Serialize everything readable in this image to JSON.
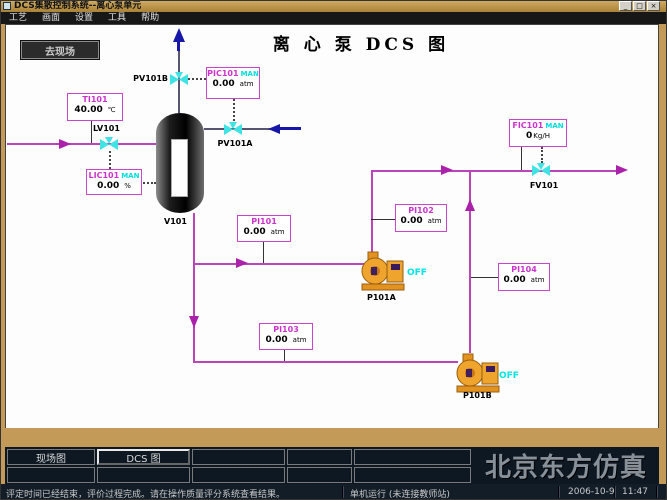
{
  "window": {
    "title": "DCS集散控制系统--离心泵单元",
    "minimize": "_",
    "maximize": "□",
    "close": "×"
  },
  "menu": {
    "items": [
      "工艺",
      "画面",
      "设置",
      "工具",
      "帮助"
    ]
  },
  "toolbar": {
    "go_field": "去现场"
  },
  "diagram": {
    "title": "离 心 泵 DCS 图",
    "vessel": {
      "label": "V101"
    },
    "valves": {
      "lv101": "LV101",
      "pv101a": "PV101A",
      "pv101b": "PV101B",
      "fv101": "FV101"
    },
    "pumps": {
      "p101a": {
        "label": "P101A",
        "status": "OFF"
      },
      "p101b": {
        "label": "P101B",
        "status": "OFF"
      }
    },
    "instruments": {
      "ti101": {
        "tag": "TI101",
        "value": "40.00",
        "unit": "℃"
      },
      "lic101": {
        "tag": "LIC101",
        "mode": "MAN",
        "value": "0.00",
        "unit": "%"
      },
      "pic101": {
        "tag": "PIC101",
        "mode": "MAN",
        "value": "0.00",
        "unit": "atm"
      },
      "fic101": {
        "tag": "FIC101",
        "mode": "MAN",
        "value": "0",
        "unit": "Kg/H"
      },
      "pi101": {
        "tag": "PI101",
        "value": "0.00",
        "unit": "atm"
      },
      "pi102": {
        "tag": "PI102",
        "value": "0.00",
        "unit": "atm"
      },
      "pi103": {
        "tag": "PI103",
        "value": "0.00",
        "unit": "atm"
      },
      "pi104": {
        "tag": "PI104",
        "value": "0.00",
        "unit": "atm"
      }
    }
  },
  "tabs": {
    "field": "现场图",
    "dcs": "DCS 图"
  },
  "branding": {
    "text": "北京东方仿真"
  },
  "statusbar": {
    "message": "评定时间已经结束，评价过程完成。请在操作质量评分系统查看结果。",
    "mode": "单机运行 (未连接教师站)",
    "date": "2006-10-9",
    "time": "11:47"
  },
  "colors": {
    "pipe_magenta": "#bb44bb",
    "arrow_navy": "#1818a8",
    "valve_cyan": "#3fe3e3",
    "instrument_border": "#cc44cc",
    "man_mode": "#00dddd",
    "pump_off": "#00e5e5",
    "titlebar_gold": "#b8914a",
    "panel_dark": "#0e1822"
  }
}
